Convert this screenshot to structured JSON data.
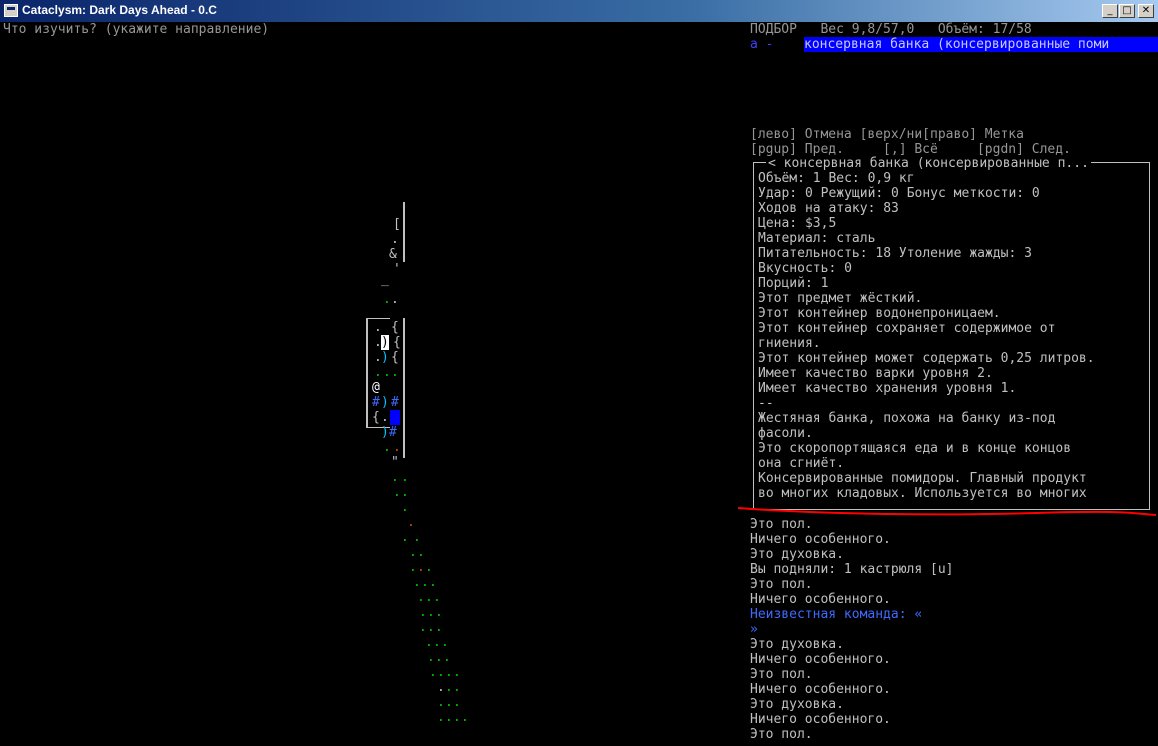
{
  "window": {
    "title": "Cataclysm: Dark Days Ahead - 0.C",
    "min": "_",
    "max": "□",
    "close": "✕"
  },
  "prompt": "Что изучить? (укажите направление)",
  "pickup": {
    "header": "ПОДБОР   Вес 9,8/57,0   Объём: 17/58",
    "selected_key": "a -",
    "selected_item": "консервная банка (консервированные поми"
  },
  "help": {
    "line1": "[лево] Отмена [верх/ни[право] Метка",
    "line2": "[pgup] Пред.     [,] Всё     [pgdn] След."
  },
  "info": {
    "title": "< консервная банка (консервированные п...",
    "lines": [
      "Объём: 1 Вес: 0,9 кг",
      "Удар: 0 Режущий: 0 Бонус меткости: 0",
      "Ходов на атаку: 83",
      "Цена: $3,5",
      "Материал: сталь",
      "Питательность: 18 Утоление жажды: 3",
      "Вкусность: 0",
      "Порций: 1",
      "Этот предмет жёсткий.",
      "Этот контейнер водонепроницаем.",
      "Этот контейнер сохраняет содержимое от",
      "гниения.",
      "Этот контейнер может содержать 0,25 литров.",
      "Имеет качество варки уровня 2.",
      "Имеет качество хранения уровня 1.",
      "--",
      "Жестяная банка, похожа на банку из-под",
      "фасоли.",
      "Это скоропортящаяся еда и в конце концов",
      "она сгниёт.",
      "Консервированные помидоры. Главный продукт",
      "во многих кладовых. Используется во многих"
    ]
  },
  "log": [
    {
      "text": "Это пол.",
      "color": "#c0c0c0"
    },
    {
      "text": "Ничего особенного.",
      "color": "#c0c0c0"
    },
    {
      "text": "Это духовка.",
      "color": "#c0c0c0"
    },
    {
      "text": "Вы подняли: 1 кастрюля [u]",
      "color": "#c0c0c0"
    },
    {
      "text": "Это пол.",
      "color": "#c0c0c0"
    },
    {
      "text": "Ничего особенного.",
      "color": "#c0c0c0"
    },
    {
      "text": "Неизвестная команда: «",
      "color": "#3f6aff"
    },
    {
      "text": "»",
      "color": "#3f6aff"
    },
    {
      "text": "Это духовка.",
      "color": "#c0c0c0"
    },
    {
      "text": "Ничего особенного.",
      "color": "#c0c0c0"
    },
    {
      "text": "Это пол.",
      "color": "#c0c0c0"
    },
    {
      "text": "Ничего особенного.",
      "color": "#c0c0c0"
    },
    {
      "text": "Это духовка.",
      "color": "#c0c0c0"
    },
    {
      "text": "Ничего особенного.",
      "color": "#c0c0c0"
    },
    {
      "text": "Это пол.",
      "color": "#c0c0c0"
    }
  ],
  "map": {
    "player": "@",
    "cursor": ")",
    "tiles": [
      {
        "ch": "[",
        "color": "#c0c0c0"
      },
      {
        "ch": ".",
        "color": "#c0c0c0"
      },
      {
        "ch": "&",
        "color": "#c0c0c0"
      },
      {
        "ch": "_",
        "color": "#c0c0c0"
      },
      {
        "ch": "'",
        "color": "#c0c0c0"
      },
      {
        "ch": ".",
        "color": "#00c000"
      },
      {
        "ch": "{",
        "color": "#c0c0c0"
      },
      {
        "ch": ")",
        "color": "#00c0ff"
      },
      {
        "ch": "#",
        "color": "#3f6aff"
      },
      {
        "ch": "\"",
        "color": "#c0c0c0"
      },
      {
        "ch": ".",
        "color": "#c05000"
      }
    ]
  },
  "colors": {
    "background": "#000000",
    "text": "#c0c0c0",
    "highlight": "#0000ff",
    "annotation": "#ff0000"
  }
}
